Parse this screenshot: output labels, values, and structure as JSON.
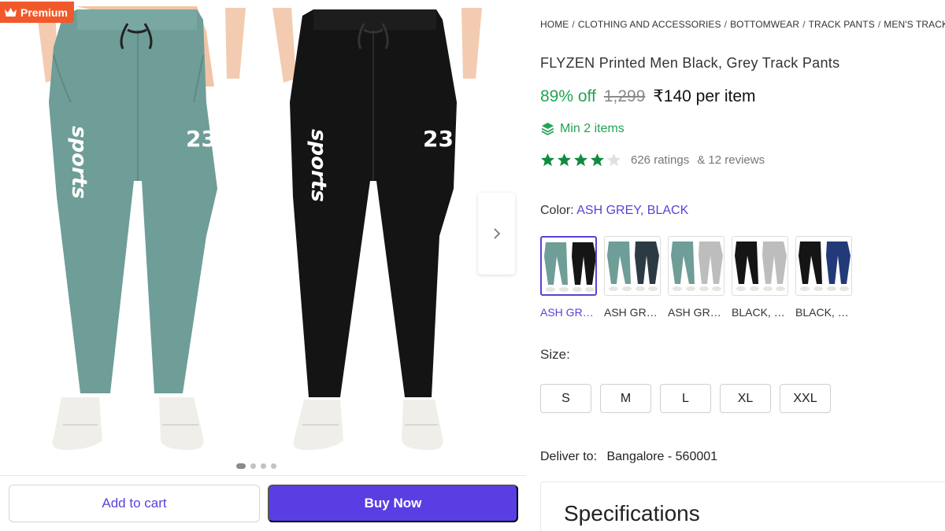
{
  "gallery": {
    "badge": "Premium",
    "badge_color": "#f1592a",
    "dots_count": 4,
    "active_dot": 1,
    "left_pant": {
      "color": "#6f9d98",
      "text": "sports",
      "number": "23"
    },
    "right_pant": {
      "color": "#141414",
      "text": "sports",
      "number": "23"
    }
  },
  "actions": {
    "add_to_cart": "Add to cart",
    "buy_now": "Buy Now",
    "accent": "#5a3ee3"
  },
  "breadcrumb": [
    "HOME",
    "CLOTHING AND ACCESSORIES",
    "BOTTOMWEAR",
    "TRACK PANTS",
    "MEN'S TRACK PANTS"
  ],
  "product": {
    "title": "FLYZEN Printed Men Black, Grey Track Pants",
    "discount": "89% off",
    "mrp": "1,299",
    "price": "₹140 per item",
    "min_items": "Min 2 items",
    "rating": 4,
    "ratings_count": "626 ratings",
    "reviews_count": "& 12 reviews"
  },
  "color": {
    "label": "Color:",
    "value": "ASH GREY, BLACK",
    "options": [
      {
        "label": "ASH GREY, BLACK",
        "selected": true,
        "colors": [
          "#6f9d98",
          "#151515"
        ]
      },
      {
        "label": "ASH GREY, NAVY",
        "selected": false,
        "colors": [
          "#6f9d98",
          "#2c3a44"
        ]
      },
      {
        "label": "ASH GREY, GREY",
        "selected": false,
        "colors": [
          "#6f9d98",
          "#bdbdbd"
        ]
      },
      {
        "label": "BLACK, GREY",
        "selected": false,
        "colors": [
          "#151515",
          "#bdbdbd"
        ]
      },
      {
        "label": "BLACK, NAVY",
        "selected": false,
        "colors": [
          "#151515",
          "#233a78"
        ]
      }
    ]
  },
  "size": {
    "label": "Size:",
    "options": [
      "S",
      "M",
      "L",
      "XL",
      "XXL"
    ]
  },
  "delivery": {
    "label": "Deliver to:",
    "location": "Bangalore - 560001"
  },
  "specifications": {
    "title": "Specifications"
  }
}
